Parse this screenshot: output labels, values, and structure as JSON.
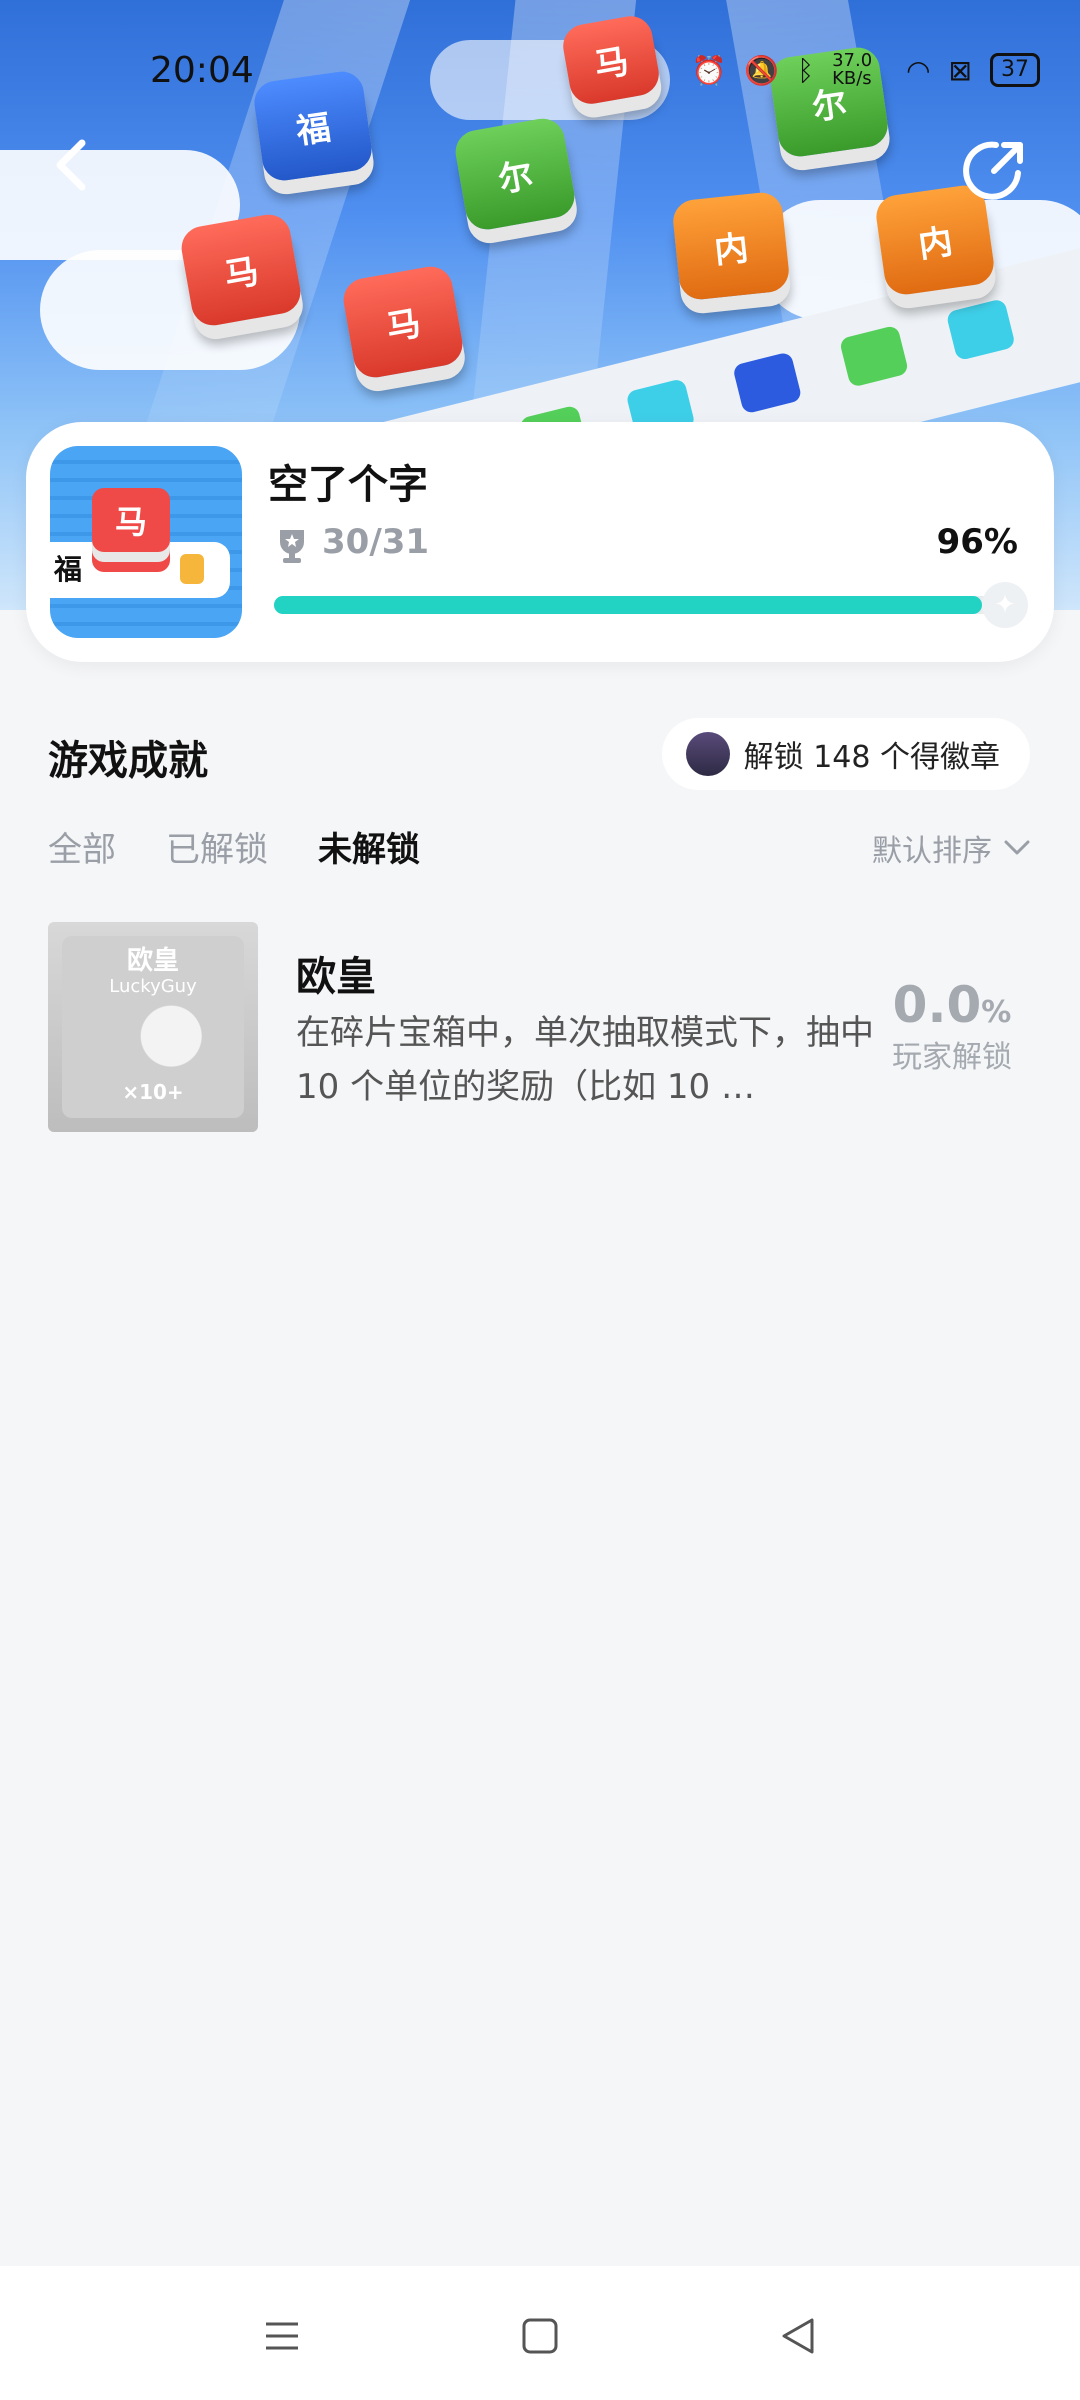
{
  "status_bar": {
    "time": "20:04",
    "speed": "37.0 KB/s",
    "battery": "37"
  },
  "hero": {
    "tiles": [
      "马",
      "福",
      "尔",
      "马",
      "内",
      "内",
      "马",
      "尔"
    ]
  },
  "game": {
    "title": "空了个字",
    "icon_tile": "马",
    "icon_side": "福",
    "achievements_text": "30/31",
    "percent_text": "96%",
    "progress": 0.96
  },
  "section": {
    "title": "游戏成就",
    "badge_pill": "解锁 148 个得徽章"
  },
  "tabs": [
    {
      "label": "全部",
      "active": false
    },
    {
      "label": "已解锁",
      "active": false
    },
    {
      "label": "未解锁",
      "active": true
    }
  ],
  "sort": {
    "label": "默认排序"
  },
  "achievements": [
    {
      "title": "欧皇",
      "badge_name": "欧皇",
      "badge_sub": "LuckyGuy",
      "badge_mark": "×10+",
      "description": "在碎片宝箱中，单次抽取模式下，抽中 10 个单位的奖励（比如 10 …",
      "rate": "0.0",
      "rate_unit": "%",
      "rate_label": "玩家解锁"
    }
  ],
  "nav": [
    "menu-icon",
    "home-icon",
    "back-icon"
  ]
}
